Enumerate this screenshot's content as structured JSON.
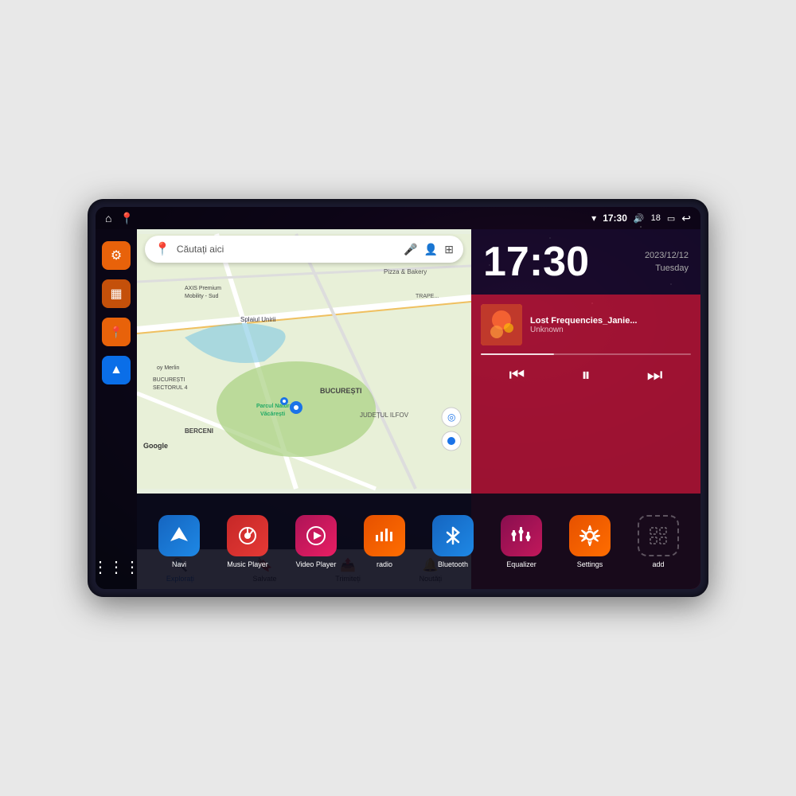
{
  "device": {
    "screen_bg": "#0a0a1a"
  },
  "status_bar": {
    "wifi_icon": "▾",
    "time": "17:30",
    "volume_icon": "🔊",
    "battery_level": "18",
    "battery_icon": "🔋",
    "back_icon": "↩"
  },
  "map": {
    "search_placeholder": "Căutați aici",
    "locations": [
      "AXIS Premium Mobility - Sud",
      "Pizza & Bakery",
      "TRAPEZULUI",
      "Parcul Natural Văcărești",
      "BUCUREȘTI",
      "SECTORUL 4",
      "BERCENI",
      "JUDEȚUL ILFOV"
    ],
    "bottom_nav": [
      {
        "label": "Explorați",
        "icon": "📍",
        "active": true
      },
      {
        "label": "Salvate",
        "icon": "🔖",
        "active": false
      },
      {
        "label": "Trimiteți",
        "icon": "📤",
        "active": false
      },
      {
        "label": "Noutăți",
        "icon": "🔔",
        "active": false
      }
    ]
  },
  "clock": {
    "time": "17:30",
    "date": "2023/12/12",
    "day": "Tuesday"
  },
  "music": {
    "title": "Lost Frequencies_Janie...",
    "artist": "Unknown",
    "progress": 35
  },
  "apps": [
    {
      "id": "navi",
      "label": "Navi",
      "icon_class": "icon-navi",
      "icon": "▲"
    },
    {
      "id": "music-player",
      "label": "Music Player",
      "icon_class": "icon-music",
      "icon": "♪"
    },
    {
      "id": "video-player",
      "label": "Video Player",
      "icon_class": "icon-video",
      "icon": "▶"
    },
    {
      "id": "radio",
      "label": "radio",
      "icon_class": "icon-radio",
      "icon": "📶"
    },
    {
      "id": "bluetooth",
      "label": "Bluetooth",
      "icon_class": "icon-bluetooth",
      "icon": "🔷"
    },
    {
      "id": "equalizer",
      "label": "Equalizer",
      "icon_class": "icon-eq",
      "icon": "≡"
    },
    {
      "id": "settings",
      "label": "Settings",
      "icon_class": "icon-settings",
      "icon": "⚙"
    },
    {
      "id": "add",
      "label": "add",
      "icon_class": "icon-add",
      "icon": "+"
    }
  ],
  "sidebar": {
    "items": [
      {
        "id": "settings",
        "icon": "⚙",
        "color": "orange"
      },
      {
        "id": "folder",
        "icon": "▦",
        "color": "dark-orange"
      },
      {
        "id": "map-pin",
        "icon": "📍",
        "color": "orange2"
      },
      {
        "id": "nav",
        "icon": "▲",
        "color": "nav-arrow"
      }
    ]
  },
  "music_controls": {
    "prev": "⏮",
    "pause": "⏸",
    "next": "⏭"
  }
}
